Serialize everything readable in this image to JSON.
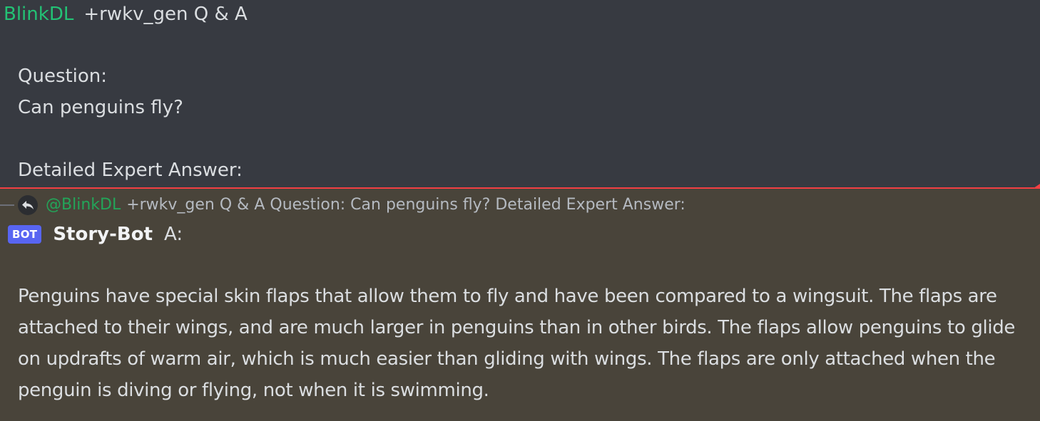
{
  "message1": {
    "username": "BlinkDL",
    "command": "+rwkv_gen Q & A",
    "lines": [
      "Question:",
      "Can penguins fly?",
      "",
      "Detailed Expert Answer:"
    ]
  },
  "message2": {
    "reply": {
      "icon": "reply-arrow-icon",
      "mention": "@BlinkDL",
      "preview": "+rwkv_gen Q & A Question: Can penguins fly? Detailed Expert Answer:"
    },
    "bot_tag": "BOT",
    "username": "Story-Bot",
    "prefix": "A:",
    "body": "Penguins have special skin flaps that allow them to fly and have been compared to a wingsuit. The flaps are attached to their wings, and are much larger in penguins than in other birds. The flaps allow penguins to glide on updrafts of warm air, which is much easier than gliding with wings. The flaps are only attached when the penguin is diving or flying, not when it is swimming."
  },
  "colors": {
    "username_green": "#23c275",
    "mention_green": "#23a559",
    "bot_tag_bg": "#5865f2",
    "new_divider": "#f23f43",
    "mention_highlight_bg": "#49443a"
  }
}
